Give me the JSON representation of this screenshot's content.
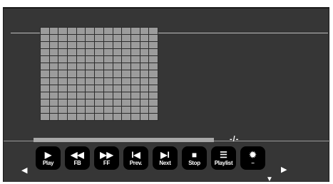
{
  "player": {
    "time_readout": "-/-",
    "progress": 0,
    "controls": [
      {
        "name": "play-button",
        "icon_name": "play-icon",
        "glyph": "▶",
        "label": "Play"
      },
      {
        "name": "fast-backward-button",
        "icon_name": "rewind-icon",
        "glyph": "◀◀",
        "label": "FB"
      },
      {
        "name": "fast-forward-button",
        "icon_name": "fast-forward-icon",
        "glyph": "▶▶",
        "label": "FF"
      },
      {
        "name": "previous-button",
        "icon_name": "skip-previous-icon",
        "glyph": "I◀",
        "label": "Prev."
      },
      {
        "name": "next-button",
        "icon_name": "skip-next-icon",
        "glyph": "▶I",
        "label": "Next"
      },
      {
        "name": "stop-button",
        "icon_name": "stop-icon",
        "glyph": "■",
        "label": "Stop"
      },
      {
        "name": "playlist-button",
        "icon_name": "playlist-icon",
        "glyph": "☰",
        "label": "Playlist"
      },
      {
        "name": "volume-button",
        "icon_name": "volume-icon",
        "glyph": "✹",
        "label": "–"
      }
    ],
    "nav": {
      "left_arrow": "◀",
      "right_arrow": "▶",
      "down_arrow": "▼"
    },
    "colors": {
      "background": "#363636",
      "button": "#000000",
      "grid_cell": "#9c9c9c"
    }
  }
}
